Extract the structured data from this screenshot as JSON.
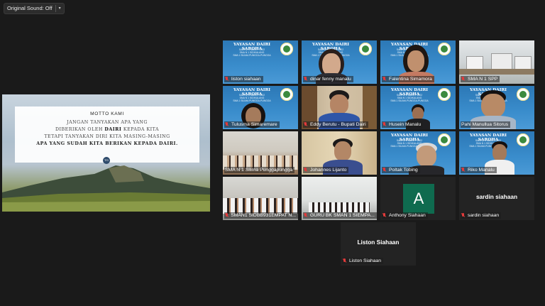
{
  "toolbar": {
    "original_sound_label": "Original Sound: Off"
  },
  "share": {
    "motto_title": "MOTTO KAMI",
    "line1": "JANGAN TANYAKAN APA YANG",
    "line2_a": "DIBERIKAN OLEH ",
    "line2_b": "DAIRI",
    "line2_c": " KEPADA KITA",
    "line3": "TETAPI TANYAKAN DIRI KITA MASING-MASING",
    "line4": "APA YANG SUDAH KITA BERIKAN KEPADA DAIRI.",
    "badge": "TG"
  },
  "banner": {
    "title": "YAYASAN DAIRI SAROHA",
    "sub1": "SABTU, 5 MARET 2022",
    "sub2": "SMA N 1 SIDIKALANG",
    "sub3": "SMA 1 SILIMA PUNGGA-PUNGGA"
  },
  "participants": [
    {
      "name": "liston siahaan",
      "muted": true
    },
    {
      "name": "dinar fenny manalu",
      "muted": true
    },
    {
      "name": "Falentina Simamora",
      "muted": true
    },
    {
      "name": "SMA N 1 SPP",
      "muted": true
    },
    {
      "name": "Tulusma Simaremare",
      "muted": true
    },
    {
      "name": "Eddy Berutu - Bupati Dairi",
      "muted": true
    },
    {
      "name": "Husein Manalu",
      "muted": true
    },
    {
      "name": "Pahi Manullua Sitorus",
      "muted": false
    },
    {
      "name": "SMA N 1 Silima Punggapungga",
      "muted": false
    },
    {
      "name": "Johannes Lijanto",
      "muted": true
    },
    {
      "name": "Poltak Tobing",
      "muted": true
    },
    {
      "name": "Riko Manalu",
      "muted": true
    },
    {
      "name": "SMAN1 SIDBB931EMPAT N...",
      "muted": true
    },
    {
      "name": "GURU BK SMAN 1 SIEMPA...",
      "muted": true
    },
    {
      "name": "Anthony Siahaan",
      "muted": true,
      "avatar_letter": "A"
    },
    {
      "name": "sardin siahaan",
      "muted": true,
      "big_name": "sardin siahaan"
    },
    {
      "name": "Liston Siahaan",
      "muted": true,
      "big_name": "Liston Siahaan"
    }
  ]
}
